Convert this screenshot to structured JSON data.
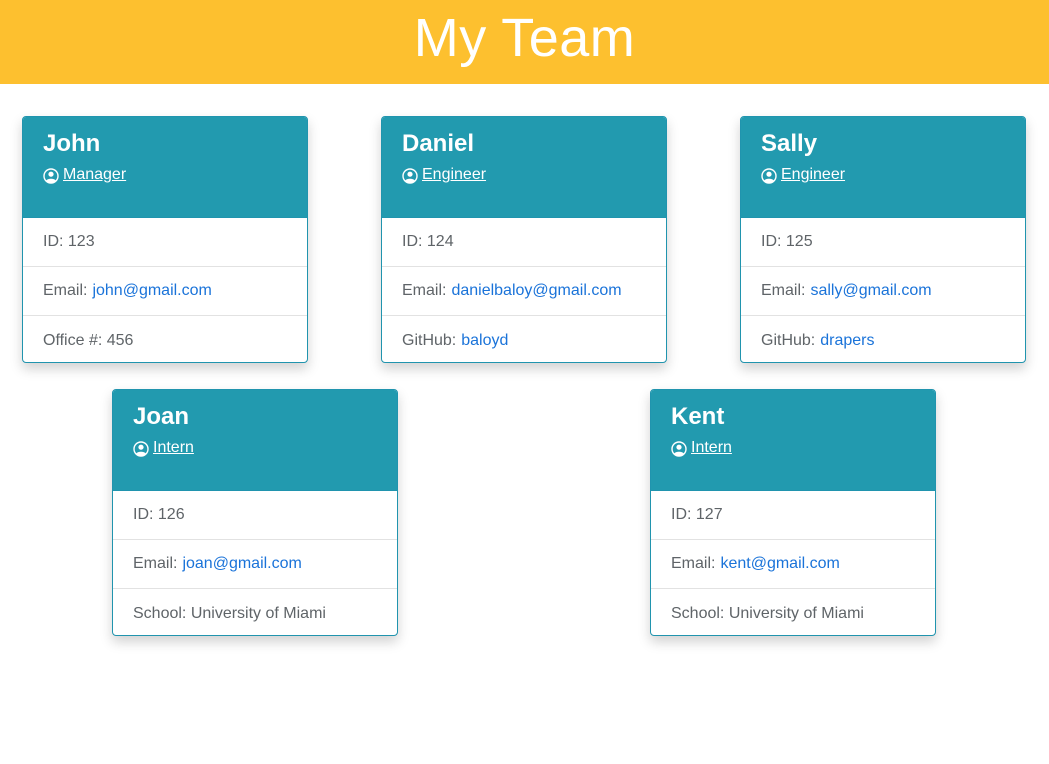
{
  "header": {
    "title": "My Team"
  },
  "team": [
    {
      "name": "John",
      "role": "Manager",
      "role_icon": "user-circle-icon",
      "id_label": "ID: 123",
      "email_label": "Email:",
      "email": "john@gmail.com",
      "extra_label": "Office #: 456",
      "extra_link": ""
    },
    {
      "name": "Daniel",
      "role": "Engineer",
      "role_icon": "user-circle-icon",
      "id_label": "ID: 124",
      "email_label": "Email:",
      "email": "danielbaloy@gmail.com",
      "extra_label": "GitHub:",
      "extra_link": "baloyd"
    },
    {
      "name": "Sally",
      "role": "Engineer",
      "role_icon": "user-circle-icon",
      "id_label": "ID: 125",
      "email_label": "Email:",
      "email": "sally@gmail.com",
      "extra_label": "GitHub:",
      "extra_link": "drapers"
    },
    {
      "name": "Joan",
      "role": "Intern",
      "role_icon": "user-circle-icon",
      "id_label": "ID: 126",
      "email_label": "Email:",
      "email": "joan@gmail.com",
      "extra_label": "School: University of Miami",
      "extra_link": ""
    },
    {
      "name": "Kent",
      "role": "Intern",
      "role_icon": "user-circle-icon",
      "id_label": "ID: 127",
      "email_label": "Email:",
      "email": "kent@gmail.com",
      "extra_label": "School: University of Miami",
      "extra_link": ""
    }
  ],
  "colors": {
    "header_bg": "#fdc02f",
    "card_header_bg": "#229aaf",
    "link": "#1a73d9",
    "text_muted": "#5f6468"
  }
}
